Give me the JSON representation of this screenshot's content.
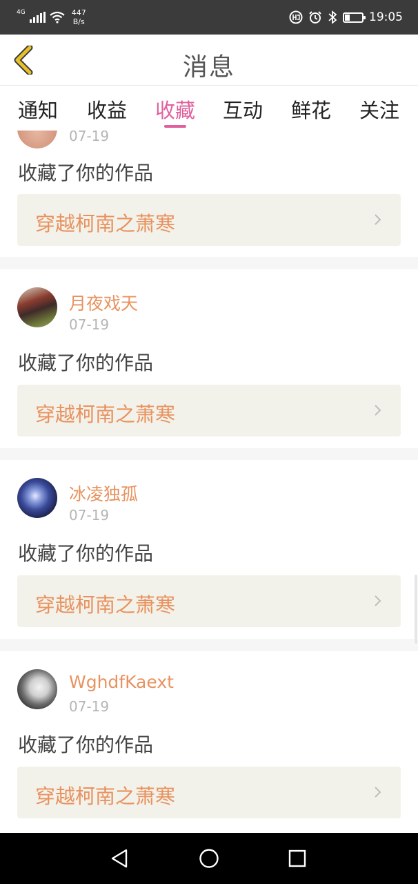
{
  "status_bar": {
    "network": "4G",
    "speed_value": "447",
    "speed_unit": "B/s",
    "battery_level": 0.25,
    "time": "19:05",
    "icons": [
      "signal-icon",
      "wifi-icon",
      "hd-icon",
      "alarm-icon",
      "bluetooth-icon",
      "battery-icon"
    ]
  },
  "header": {
    "title": "消息",
    "back_icon": "chevron-left-icon",
    "back_icon_color": "#e8c12a"
  },
  "tabs": [
    {
      "label": "通知",
      "active": false
    },
    {
      "label": "收益",
      "active": false
    },
    {
      "label": "收藏",
      "active": true
    },
    {
      "label": "互动",
      "active": false
    },
    {
      "label": "鲜花",
      "active": false
    },
    {
      "label": "关注",
      "active": false
    }
  ],
  "colors": {
    "accent": "#e0609e",
    "username": "#e8925f",
    "work_bg": "#f3f2ea",
    "divider": "#f6f6f6"
  },
  "notifications": [
    {
      "username": "",
      "date": "07-19",
      "action": "收藏了你的作品",
      "work_title": "穿越柯南之萧寒",
      "avatar": "partial-avatar"
    },
    {
      "username": "月夜戏天",
      "date": "07-19",
      "action": "收藏了你的作品",
      "work_title": "穿越柯南之萧寒",
      "avatar": "anime-character-avatar"
    },
    {
      "username": "冰凌独孤",
      "date": "07-19",
      "action": "收藏了你的作品",
      "work_title": "穿越柯南之萧寒",
      "avatar": "galaxy-avatar"
    },
    {
      "username": "WghdfKaext",
      "date": "07-19",
      "action": "收藏了你的作品",
      "work_title": "穿越柯南之萧寒",
      "avatar": "sketch-portrait-avatar"
    }
  ],
  "nav_bar": {
    "buttons": [
      "back-triangle-icon",
      "home-circle-icon",
      "recents-square-icon"
    ]
  }
}
